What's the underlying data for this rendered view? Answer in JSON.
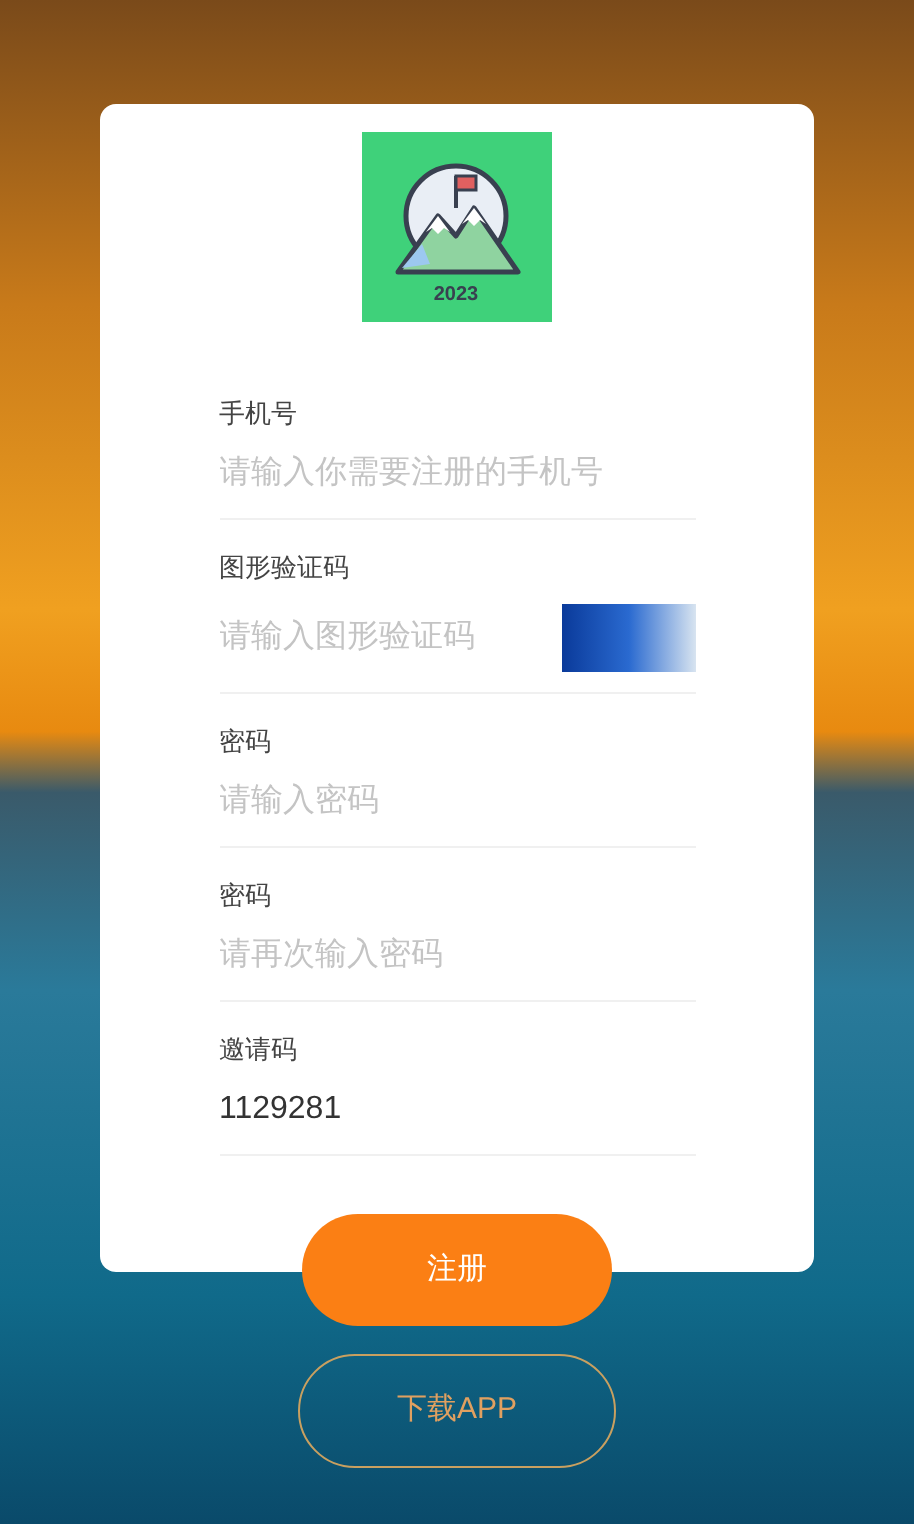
{
  "logo": {
    "year": "2023"
  },
  "fields": [
    {
      "kind": "text",
      "label": "手机号",
      "placeholder": "请输入你需要注册的手机号"
    },
    {
      "kind": "captcha",
      "label": "图形验证码",
      "placeholder": "请输入图形验证码"
    },
    {
      "kind": "text",
      "label": "密码",
      "placeholder": "请输入密码"
    },
    {
      "kind": "text",
      "label": "密码",
      "placeholder": "请再次输入密码"
    },
    {
      "kind": "text",
      "label": "邀请码",
      "value": "1129281"
    }
  ],
  "register_button": "注册",
  "download_button": "下载APP"
}
